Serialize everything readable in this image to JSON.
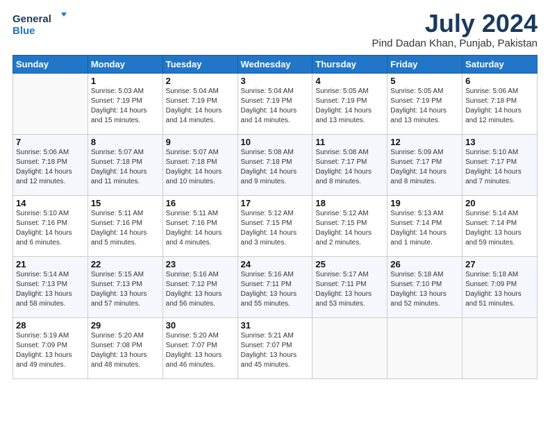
{
  "app": {
    "logo_line1": "General",
    "logo_line2": "Blue"
  },
  "header": {
    "month": "July 2024",
    "location": "Pind Dadan Khan, Punjab, Pakistan"
  },
  "weekdays": [
    "Sunday",
    "Monday",
    "Tuesday",
    "Wednesday",
    "Thursday",
    "Friday",
    "Saturday"
  ],
  "weeks": [
    [
      {
        "day": "",
        "info": ""
      },
      {
        "day": "1",
        "info": "Sunrise: 5:03 AM\nSunset: 7:19 PM\nDaylight: 14 hours\nand 15 minutes."
      },
      {
        "day": "2",
        "info": "Sunrise: 5:04 AM\nSunset: 7:19 PM\nDaylight: 14 hours\nand 14 minutes."
      },
      {
        "day": "3",
        "info": "Sunrise: 5:04 AM\nSunset: 7:19 PM\nDaylight: 14 hours\nand 14 minutes."
      },
      {
        "day": "4",
        "info": "Sunrise: 5:05 AM\nSunset: 7:19 PM\nDaylight: 14 hours\nand 13 minutes."
      },
      {
        "day": "5",
        "info": "Sunrise: 5:05 AM\nSunset: 7:19 PM\nDaylight: 14 hours\nand 13 minutes."
      },
      {
        "day": "6",
        "info": "Sunrise: 5:06 AM\nSunset: 7:18 PM\nDaylight: 14 hours\nand 12 minutes."
      }
    ],
    [
      {
        "day": "7",
        "info": "Sunrise: 5:06 AM\nSunset: 7:18 PM\nDaylight: 14 hours\nand 12 minutes."
      },
      {
        "day": "8",
        "info": "Sunrise: 5:07 AM\nSunset: 7:18 PM\nDaylight: 14 hours\nand 11 minutes."
      },
      {
        "day": "9",
        "info": "Sunrise: 5:07 AM\nSunset: 7:18 PM\nDaylight: 14 hours\nand 10 minutes."
      },
      {
        "day": "10",
        "info": "Sunrise: 5:08 AM\nSunset: 7:18 PM\nDaylight: 14 hours\nand 9 minutes."
      },
      {
        "day": "11",
        "info": "Sunrise: 5:08 AM\nSunset: 7:17 PM\nDaylight: 14 hours\nand 8 minutes."
      },
      {
        "day": "12",
        "info": "Sunrise: 5:09 AM\nSunset: 7:17 PM\nDaylight: 14 hours\nand 8 minutes."
      },
      {
        "day": "13",
        "info": "Sunrise: 5:10 AM\nSunset: 7:17 PM\nDaylight: 14 hours\nand 7 minutes."
      }
    ],
    [
      {
        "day": "14",
        "info": "Sunrise: 5:10 AM\nSunset: 7:16 PM\nDaylight: 14 hours\nand 6 minutes."
      },
      {
        "day": "15",
        "info": "Sunrise: 5:11 AM\nSunset: 7:16 PM\nDaylight: 14 hours\nand 5 minutes."
      },
      {
        "day": "16",
        "info": "Sunrise: 5:11 AM\nSunset: 7:16 PM\nDaylight: 14 hours\nand 4 minutes."
      },
      {
        "day": "17",
        "info": "Sunrise: 5:12 AM\nSunset: 7:15 PM\nDaylight: 14 hours\nand 3 minutes."
      },
      {
        "day": "18",
        "info": "Sunrise: 5:12 AM\nSunset: 7:15 PM\nDaylight: 14 hours\nand 2 minutes."
      },
      {
        "day": "19",
        "info": "Sunrise: 5:13 AM\nSunset: 7:14 PM\nDaylight: 14 hours\nand 1 minute."
      },
      {
        "day": "20",
        "info": "Sunrise: 5:14 AM\nSunset: 7:14 PM\nDaylight: 13 hours\nand 59 minutes."
      }
    ],
    [
      {
        "day": "21",
        "info": "Sunrise: 5:14 AM\nSunset: 7:13 PM\nDaylight: 13 hours\nand 58 minutes."
      },
      {
        "day": "22",
        "info": "Sunrise: 5:15 AM\nSunset: 7:13 PM\nDaylight: 13 hours\nand 57 minutes."
      },
      {
        "day": "23",
        "info": "Sunrise: 5:16 AM\nSunset: 7:12 PM\nDaylight: 13 hours\nand 56 minutes."
      },
      {
        "day": "24",
        "info": "Sunrise: 5:16 AM\nSunset: 7:11 PM\nDaylight: 13 hours\nand 55 minutes."
      },
      {
        "day": "25",
        "info": "Sunrise: 5:17 AM\nSunset: 7:11 PM\nDaylight: 13 hours\nand 53 minutes."
      },
      {
        "day": "26",
        "info": "Sunrise: 5:18 AM\nSunset: 7:10 PM\nDaylight: 13 hours\nand 52 minutes."
      },
      {
        "day": "27",
        "info": "Sunrise: 5:18 AM\nSunset: 7:09 PM\nDaylight: 13 hours\nand 51 minutes."
      }
    ],
    [
      {
        "day": "28",
        "info": "Sunrise: 5:19 AM\nSunset: 7:09 PM\nDaylight: 13 hours\nand 49 minutes."
      },
      {
        "day": "29",
        "info": "Sunrise: 5:20 AM\nSunset: 7:08 PM\nDaylight: 13 hours\nand 48 minutes."
      },
      {
        "day": "30",
        "info": "Sunrise: 5:20 AM\nSunset: 7:07 PM\nDaylight: 13 hours\nand 46 minutes."
      },
      {
        "day": "31",
        "info": "Sunrise: 5:21 AM\nSunset: 7:07 PM\nDaylight: 13 hours\nand 45 minutes."
      },
      {
        "day": "",
        "info": ""
      },
      {
        "day": "",
        "info": ""
      },
      {
        "day": "",
        "info": ""
      }
    ]
  ]
}
